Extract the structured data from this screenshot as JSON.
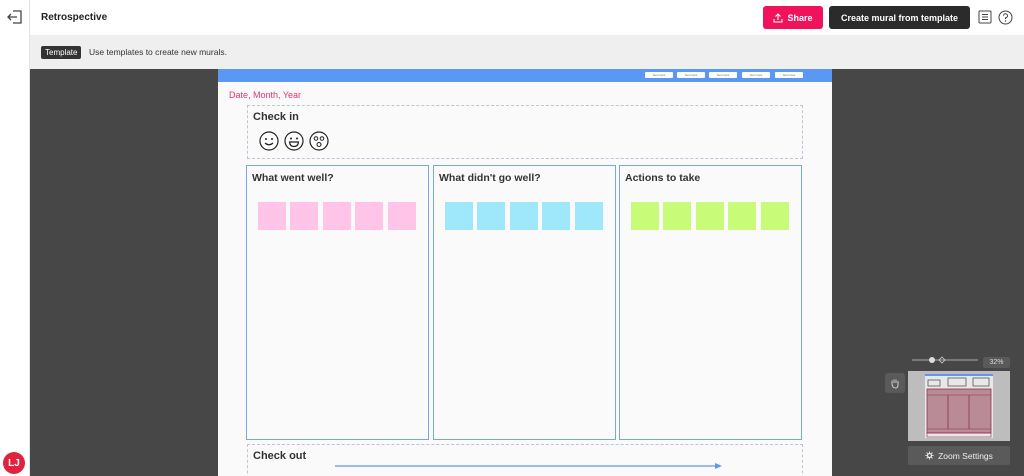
{
  "header": {
    "title": "Retrospective",
    "share_label": "Share",
    "create_label": "Create mural from template"
  },
  "banner": {
    "tag": "Template",
    "text": "Use templates to create new murals."
  },
  "user": {
    "initials": "LJ"
  },
  "board": {
    "date_label": "Date, Month, Year",
    "topbar_pills": [
      "Get more",
      "Get more",
      "Get more",
      "Get more",
      "Get more"
    ],
    "check_in": {
      "title": "Check in"
    },
    "columns": [
      {
        "title": "What went well?",
        "sticky_color": "#ffc4e8",
        "sticky_count": 5
      },
      {
        "title": "What didn't go well?",
        "sticky_color": "#9fe8fb",
        "sticky_count": 5
      },
      {
        "title": "Actions to take",
        "sticky_color": "#c8fb78",
        "sticky_count": 5
      }
    ],
    "check_out": {
      "title": "Check out"
    }
  },
  "zoom": {
    "percent": "32%",
    "settings_label": "Zoom Settings"
  },
  "colors": {
    "accent_pink": "#f0135b",
    "board_topbar": "#5b97f5",
    "column_border": "#7aa7e2",
    "date_text": "#e8336c"
  }
}
